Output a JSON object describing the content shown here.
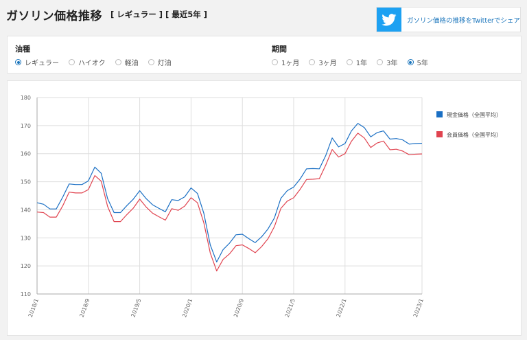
{
  "header": {
    "title": "ガソリン価格推移",
    "subtitle": "[ レギュラー ] [ 最近5年 ]",
    "share_label": "ガソリン価格の推移をTwitterでシェア",
    "share_icon": "twitter-bird-icon",
    "share_color": "#1da1f2"
  },
  "filters": {
    "oil_type": {
      "title": "油種",
      "options": [
        {
          "label": "レギュラー",
          "selected": true
        },
        {
          "label": "ハイオク",
          "selected": false
        },
        {
          "label": "軽油",
          "selected": false
        },
        {
          "label": "灯油",
          "selected": false
        }
      ]
    },
    "period": {
      "title": "期間",
      "options": [
        {
          "label": "1ヶ月",
          "selected": false
        },
        {
          "label": "3ヶ月",
          "selected": false
        },
        {
          "label": "1年",
          "selected": false
        },
        {
          "label": "3年",
          "selected": false
        },
        {
          "label": "5年",
          "selected": true
        }
      ]
    },
    "accent_color": "#1a75bc"
  },
  "chart_data": {
    "type": "line",
    "x": [
      "2018/1",
      "2018/2",
      "2018/3",
      "2018/4",
      "2018/5",
      "2018/6",
      "2018/7",
      "2018/8",
      "2018/9",
      "2018/10",
      "2018/11",
      "2018/12",
      "2019/1",
      "2019/2",
      "2019/3",
      "2019/4",
      "2019/5",
      "2019/6",
      "2019/7",
      "2019/8",
      "2019/9",
      "2019/10",
      "2019/11",
      "2019/12",
      "2020/1",
      "2020/2",
      "2020/3",
      "2020/4",
      "2020/5",
      "2020/6",
      "2020/7",
      "2020/8",
      "2020/9",
      "2020/10",
      "2020/11",
      "2020/12",
      "2021/1",
      "2021/2",
      "2021/3",
      "2021/4",
      "2021/5",
      "2021/6",
      "2021/7",
      "2021/8",
      "2021/9",
      "2021/10",
      "2021/11",
      "2021/12",
      "2022/1",
      "2022/2",
      "2022/3",
      "2022/4",
      "2022/5",
      "2022/6",
      "2022/7",
      "2022/8",
      "2022/9",
      "2022/10",
      "2022/11",
      "2022/12",
      "2023/1"
    ],
    "x_ticks": [
      "2018/1",
      "2018/9",
      "2019/5",
      "2020/1",
      "2020/9",
      "2021/5",
      "2022/1",
      "2023/1"
    ],
    "ylim": [
      110,
      180
    ],
    "y_ticks": [
      110,
      120,
      130,
      140,
      150,
      160,
      170,
      180
    ],
    "grid": true,
    "legend_position": "right",
    "series": [
      {
        "name": "現金価格（全国平均）",
        "color": "#1a6fc4",
        "values": [
          142.5,
          142.0,
          140.3,
          140.3,
          144.5,
          149.2,
          149.0,
          149.0,
          150.3,
          155.2,
          153.0,
          144.0,
          139.0,
          139.0,
          141.5,
          143.8,
          146.8,
          144.0,
          141.8,
          140.5,
          139.3,
          143.6,
          143.3,
          144.6,
          147.8,
          145.8,
          138.7,
          127.5,
          121.4,
          125.8,
          128.1,
          131.1,
          131.3,
          129.7,
          128.3,
          130.4,
          133.2,
          137.1,
          144.1,
          146.8,
          148.1,
          151.0,
          154.6,
          154.7,
          154.6,
          159.4,
          165.6,
          162.4,
          163.6,
          168.1,
          170.8,
          169.3,
          166.0,
          167.5,
          168.1,
          165.2,
          165.4,
          164.9,
          163.4,
          163.6,
          163.7
        ]
      },
      {
        "name": "会員価格（全国平均）",
        "color": "#e0434f",
        "values": [
          139.2,
          139.0,
          137.4,
          137.4,
          141.4,
          146.3,
          146.0,
          146.0,
          147.2,
          152.2,
          150.2,
          141.2,
          135.8,
          135.8,
          138.3,
          140.6,
          143.8,
          141.0,
          138.8,
          137.5,
          136.3,
          140.4,
          139.8,
          141.3,
          144.3,
          142.5,
          135.3,
          124.6,
          118.2,
          122.3,
          124.3,
          127.2,
          127.5,
          126.2,
          124.7,
          126.9,
          129.7,
          134.0,
          140.5,
          143.1,
          144.3,
          147.3,
          150.8,
          150.9,
          151.1,
          156.0,
          161.5,
          158.8,
          160.0,
          164.4,
          167.3,
          165.6,
          162.2,
          163.8,
          164.5,
          161.4,
          161.6,
          160.9,
          159.6,
          159.8,
          159.9
        ]
      }
    ]
  }
}
